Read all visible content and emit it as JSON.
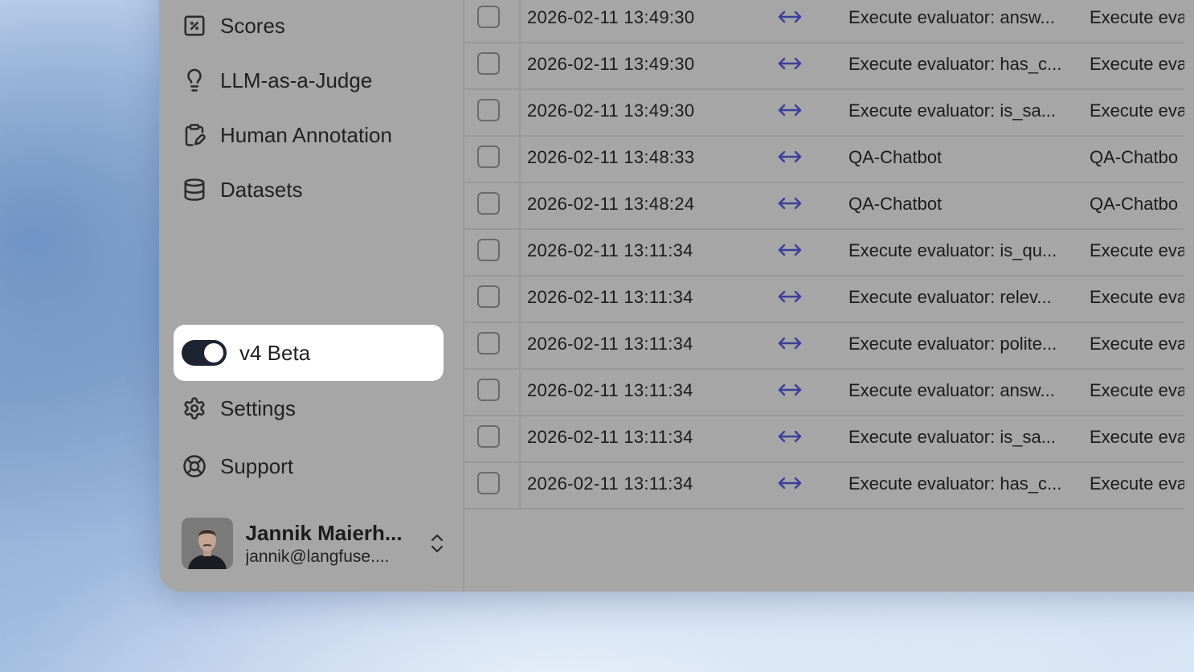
{
  "sidebar": {
    "items": [
      {
        "label": "Scores",
        "icon": "scores-icon"
      },
      {
        "label": "LLM-as-a-Judge",
        "icon": "lightbulb-icon"
      },
      {
        "label": "Human Annotation",
        "icon": "clipboard-pen-icon"
      },
      {
        "label": "Datasets",
        "icon": "database-icon"
      }
    ],
    "beta_toggle": {
      "label": "v4 Beta",
      "enabled": true
    },
    "settings_label": "Settings",
    "support_label": "Support",
    "user": {
      "name": "Jannik Maierh...",
      "email": "jannik@langfuse...."
    }
  },
  "table": {
    "rows": [
      {
        "timestamp": "2026-02-11 13:49:30",
        "name": "Execute evaluator: answ...",
        "name2": "Execute eva"
      },
      {
        "timestamp": "2026-02-11 13:49:30",
        "name": "Execute evaluator: has_c...",
        "name2": "Execute eva"
      },
      {
        "timestamp": "2026-02-11 13:49:30",
        "name": "Execute evaluator: is_sa...",
        "name2": "Execute eva"
      },
      {
        "timestamp": "2026-02-11 13:48:33",
        "name": "QA-Chatbot",
        "name2": "QA-Chatbo"
      },
      {
        "timestamp": "2026-02-11 13:48:24",
        "name": "QA-Chatbot",
        "name2": "QA-Chatbo"
      },
      {
        "timestamp": "2026-02-11 13:11:34",
        "name": "Execute evaluator: is_qu...",
        "name2": "Execute eva"
      },
      {
        "timestamp": "2026-02-11 13:11:34",
        "name": "Execute evaluator: relev...",
        "name2": "Execute eva"
      },
      {
        "timestamp": "2026-02-11 13:11:34",
        "name": "Execute evaluator: polite...",
        "name2": "Execute eva"
      },
      {
        "timestamp": "2026-02-11 13:11:34",
        "name": "Execute evaluator: answ...",
        "name2": "Execute eva"
      },
      {
        "timestamp": "2026-02-11 13:11:34",
        "name": "Execute evaluator: is_sa...",
        "name2": "Execute eva"
      },
      {
        "timestamp": "2026-02-11 13:11:34",
        "name": "Execute evaluator: has_c...",
        "name2": "Execute eva"
      }
    ]
  },
  "colors": {
    "toggle_on": "#1d2331",
    "arrow": "#3b3f9a"
  }
}
